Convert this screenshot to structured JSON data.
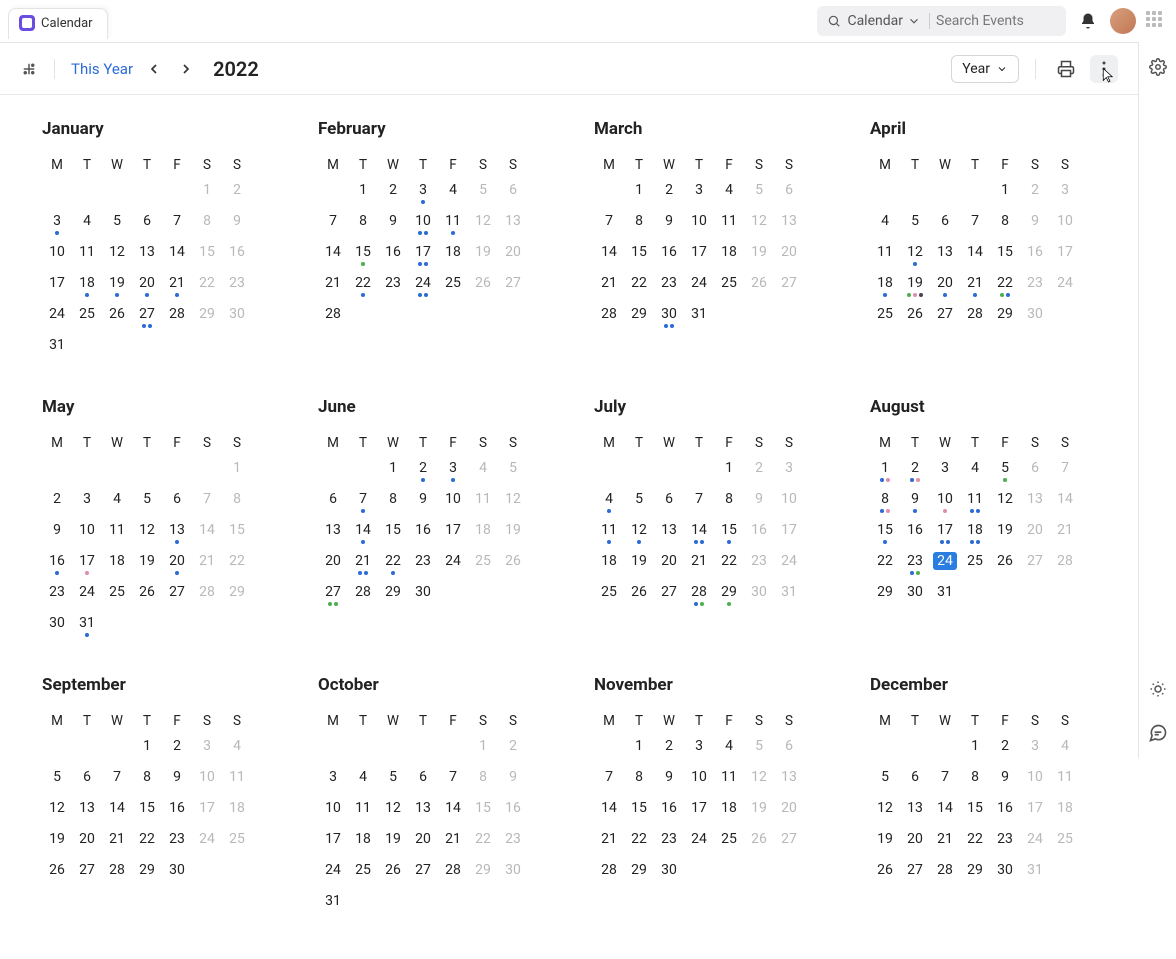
{
  "app": {
    "tab_label": "Calendar"
  },
  "topbar": {
    "search_mode": "Calendar",
    "search_placeholder": "Search Events"
  },
  "toolbar": {
    "this_year": "This Year",
    "year_display": "2022",
    "view_label": "Year"
  },
  "weekdays": [
    "M",
    "T",
    "W",
    "T",
    "F",
    "S",
    "S"
  ],
  "months": [
    {
      "name": "January",
      "offset": 5,
      "len": 31,
      "events": {
        "3": [
          "blue"
        ],
        "18": [
          "blue"
        ],
        "19": [
          "blue"
        ],
        "20": [
          "blue"
        ],
        "21": [
          "blue"
        ],
        "27": [
          "blue",
          "blue"
        ]
      }
    },
    {
      "name": "February",
      "offset": 1,
      "len": 28,
      "events": {
        "3": [
          "blue"
        ],
        "10": [
          "blue",
          "blue"
        ],
        "11": [
          "blue"
        ],
        "15": [
          "green"
        ],
        "17": [
          "blue",
          "blue"
        ],
        "22": [
          "blue"
        ],
        "24": [
          "blue",
          "blue"
        ]
      }
    },
    {
      "name": "March",
      "offset": 1,
      "len": 31,
      "events": {
        "30": [
          "blue",
          "blue"
        ]
      }
    },
    {
      "name": "April",
      "offset": 4,
      "len": 30,
      "events": {
        "12": [
          "blue"
        ],
        "18": [
          "blue"
        ],
        "19": [
          "green",
          "pink",
          "dark"
        ],
        "20": [
          "blue"
        ],
        "21": [
          "blue"
        ],
        "22": [
          "green",
          "blue"
        ]
      }
    },
    {
      "name": "May",
      "offset": 6,
      "len": 31,
      "events": {
        "13": [
          "blue"
        ],
        "16": [
          "blue"
        ],
        "17": [
          "pink"
        ],
        "20": [
          "blue"
        ],
        "31": [
          "blue"
        ]
      }
    },
    {
      "name": "June",
      "offset": 2,
      "len": 30,
      "events": {
        "2": [
          "blue"
        ],
        "3": [
          "blue"
        ],
        "7": [
          "blue"
        ],
        "14": [
          "blue"
        ],
        "21": [
          "blue",
          "blue"
        ],
        "22": [
          "blue"
        ],
        "27": [
          "green",
          "green"
        ]
      }
    },
    {
      "name": "July",
      "offset": 4,
      "len": 31,
      "events": {
        "4": [
          "blue"
        ],
        "11": [
          "blue"
        ],
        "12": [
          "blue"
        ],
        "14": [
          "blue",
          "blue"
        ],
        "15": [
          "blue"
        ],
        "28": [
          "blue",
          "green"
        ],
        "29": [
          "green"
        ]
      }
    },
    {
      "name": "August",
      "offset": 0,
      "len": 31,
      "events": {
        "1": [
          "blue",
          "pink"
        ],
        "2": [
          "blue",
          "pink"
        ],
        "5": [
          "green"
        ],
        "8": [
          "blue",
          "pink"
        ],
        "9": [
          "blue"
        ],
        "10": [
          "pink"
        ],
        "11": [
          "blue",
          "blue"
        ],
        "15": [
          "blue"
        ],
        "17": [
          "blue",
          "blue"
        ],
        "18": [
          "blue",
          "blue"
        ],
        "23": [
          "blue",
          "green"
        ]
      },
      "today": 24
    },
    {
      "name": "September",
      "offset": 3,
      "len": 30,
      "events": {}
    },
    {
      "name": "October",
      "offset": 5,
      "len": 31,
      "events": {}
    },
    {
      "name": "November",
      "offset": 1,
      "len": 30,
      "events": {}
    },
    {
      "name": "December",
      "offset": 3,
      "len": 31,
      "events": {}
    }
  ]
}
